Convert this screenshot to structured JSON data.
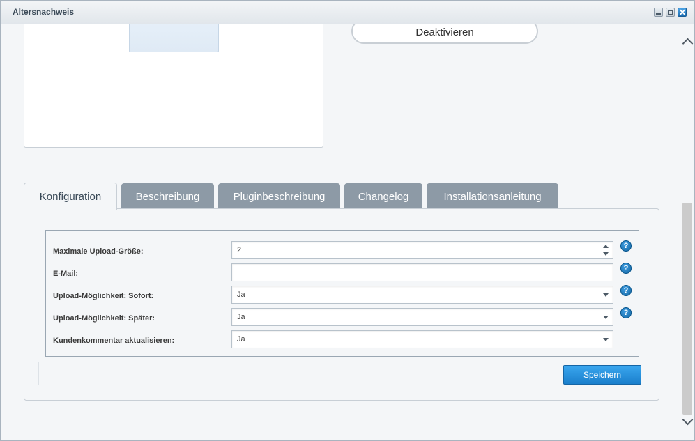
{
  "window": {
    "title": "Altersnachweis"
  },
  "top": {
    "deactivate_label": "Deaktivieren"
  },
  "tabs": [
    {
      "label": "Konfiguration",
      "active": true
    },
    {
      "label": "Beschreibung",
      "active": false
    },
    {
      "label": "Pluginbeschreibung",
      "active": false
    },
    {
      "label": "Changelog",
      "active": false
    },
    {
      "label": "Installationsanleitung",
      "active": false
    }
  ],
  "form": {
    "fields": [
      {
        "label": "Maximale Upload-Größe:",
        "value": "2",
        "type": "number",
        "help": "?"
      },
      {
        "label": "E-Mail:",
        "value": "",
        "type": "text",
        "help": "?"
      },
      {
        "label": "Upload-Möglichkeit: Sofort:",
        "value": "Ja",
        "type": "select",
        "help": "?"
      },
      {
        "label": "Upload-Möglichkeit: Später:",
        "value": "Ja",
        "type": "select",
        "help": "?"
      },
      {
        "label": "Kundenkommentar aktualisieren:",
        "value": "Ja",
        "type": "select"
      }
    ],
    "save_label": "Speichern"
  },
  "colors": {
    "accent": "#1a7fcc",
    "tab_inactive": "#8d9aa6"
  }
}
